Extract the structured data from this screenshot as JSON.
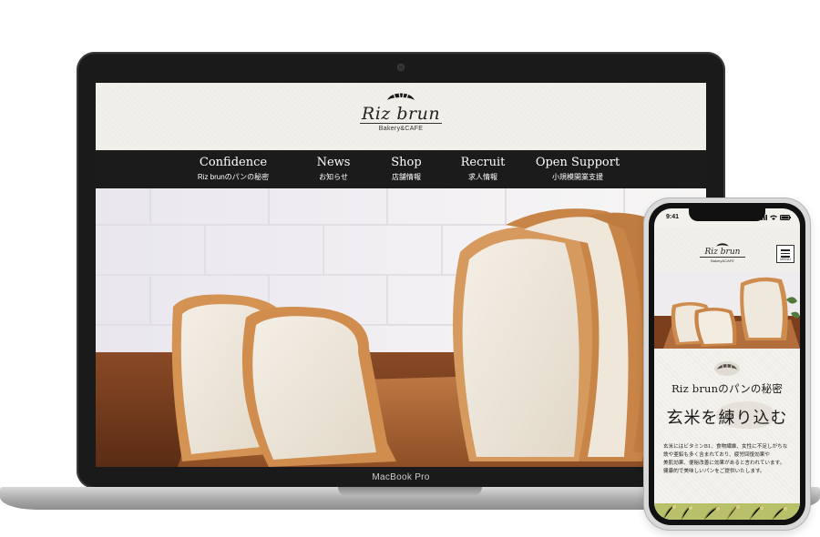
{
  "site": {
    "logo_name": "Riz brun",
    "logo_sub": "Bakery&CAFE"
  },
  "nav": [
    {
      "en": "Confidence",
      "ja": "Riz brunのパンの秘密"
    },
    {
      "en": "News",
      "ja": "お知らせ"
    },
    {
      "en": "Shop",
      "ja": "店舗情報"
    },
    {
      "en": "Recruit",
      "ja": "求人情報"
    },
    {
      "en": "Open Support",
      "ja": "小規模開業支援"
    }
  ],
  "laptop": {
    "label": "MacBook Pro"
  },
  "phone": {
    "time": "9:41",
    "menu_label": "MENU",
    "section_heading": "Riz brunのパンの秘密",
    "catch": "玄米を練り込む",
    "body_lines": [
      "玄米にはビタミンB1、食物繊維、女性に不足しがちな",
      "鉄や亜鉛も多く含まれており、疲労回復効果や",
      "美肌効果、便秘改善に効果があると言われています。",
      "健康的で美味しいパンをご提供いたします。"
    ]
  },
  "colors": {
    "nav_bg": "#1b1b1b",
    "header_bg": "#f2f0eb",
    "accent_crust": "#c98a4b"
  }
}
